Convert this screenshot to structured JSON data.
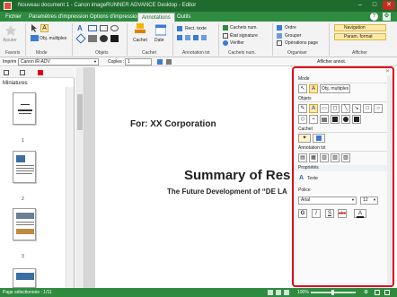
{
  "window": {
    "title": "Nouveau document 1 - Canon imageRUNNER ADVANCE Desktop - Editor"
  },
  "tabs": [
    {
      "label": "Fichier"
    },
    {
      "label": "Paramètres d'impression"
    },
    {
      "label": "Options d'impression"
    },
    {
      "label": "Annotations"
    },
    {
      "label": "Outils"
    }
  ],
  "ribbon": {
    "groups": {
      "favoris": "Favoris",
      "mode": "Mode",
      "objets": "Objets",
      "cachet": "Cachet",
      "annotation_txt": "Annotation txt",
      "cachets_num": "Cachets num.",
      "organiser": "Organiser",
      "afficher": "Afficher"
    },
    "buttons": {
      "ajouter": "Ajouter",
      "obj_multiples": "Obj. multiples",
      "cachet": "Cachet",
      "date": "Date",
      "rect_texte": "Rect. texte",
      "cachets_num": "Cachets num.",
      "etat_signature": "État signature",
      "verifier": "Vérifier",
      "ordre": "Ordre",
      "grouper": "Grouper",
      "operations_page": "Opérations page",
      "navigation": "Navigation",
      "param_format": "Param. format",
      "afficher_annot": "Afficher annot."
    }
  },
  "printbar": {
    "imprim_label": "Imprim :",
    "printer": "Canon iR-ADV",
    "copies_label": "Copies :",
    "copies_value": "1"
  },
  "left": {
    "title": "Miniatures",
    "pages": [
      "1",
      "2",
      "3"
    ]
  },
  "document": {
    "line1": "For: XX Corporation",
    "line2": "Summary of Res",
    "line3": "The Future Development of “DE LA"
  },
  "panel": {
    "mode": "Mode",
    "obj_multiples": "Obj. multiples",
    "objets": "Objets",
    "cachet": "Cachet",
    "annotation_txt": "Annotation txt",
    "proprietes": "Propriétés",
    "texte": "Texte",
    "police": "Police",
    "font_value": "Arial",
    "size_value": "12"
  },
  "status": {
    "left": "Page sélectionnée : 1/11",
    "zoom": "100%"
  },
  "colors": {
    "green": "#2e8b40",
    "red_outline": "#e0001b"
  }
}
